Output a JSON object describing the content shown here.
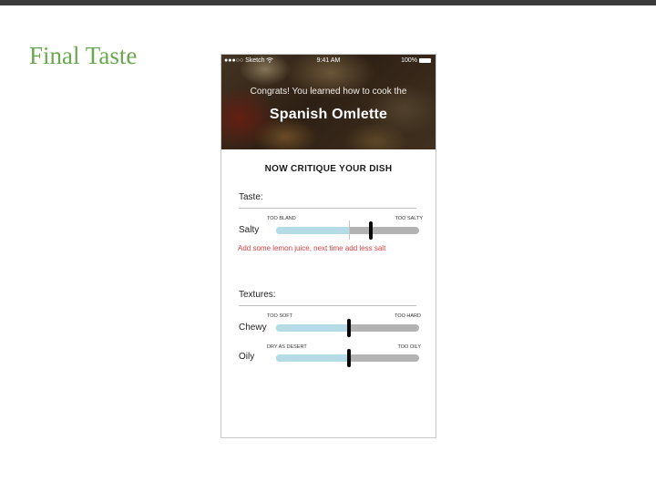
{
  "slide": {
    "title": "Final Taste"
  },
  "status_bar": {
    "carrier": "●●●○○ Sketch",
    "wifi_icon": "wifi-icon",
    "time": "9:41 AM",
    "battery": "100%"
  },
  "hero": {
    "congrats": "Congrats! You learned how to cook the",
    "dish": "Spanish Omlette"
  },
  "critique": {
    "heading": "NOW CRITIQUE YOUR DISH",
    "taste": {
      "label": "Taste:",
      "sliders": [
        {
          "name": "Salty",
          "min_label": "TOO BLAND",
          "max_label": "TOO SALTY",
          "fill": 0.51,
          "thumb": 0.66,
          "marker": 0.51
        }
      ],
      "advice": "Add some lemon juice, next time add less salt"
    },
    "textures": {
      "label": "Textures:",
      "sliders": [
        {
          "name": "Chewy",
          "min_label": "TOO SOFT",
          "max_label": "TOO HARD",
          "fill": 0.51,
          "thumb": 0.51
        },
        {
          "name": "Oily",
          "min_label": "DRY AS DESERT",
          "max_label": "TOO OILY",
          "fill": 0.51,
          "thumb": 0.51
        }
      ]
    }
  },
  "colors": {
    "title_green": "#6aa84f",
    "fill_blue": "#b5dce6",
    "track_gray": "#b3b3b3",
    "advice_red": "#d94141"
  }
}
